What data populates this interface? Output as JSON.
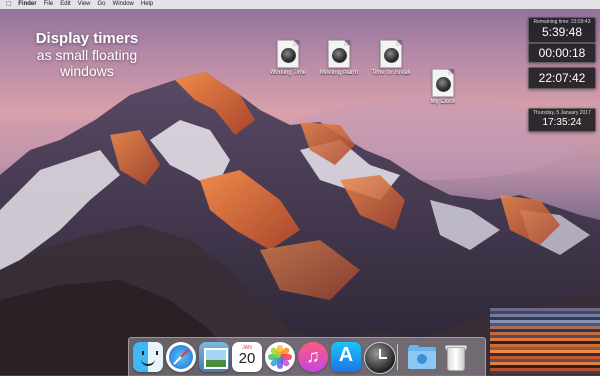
{
  "menubar": {
    "apple_icon": "apple-logo",
    "items": [
      "Finder",
      "File",
      "Edit",
      "View",
      "Go",
      "Window",
      "Help"
    ]
  },
  "promo": {
    "line1": "Display timers",
    "line2": "as small floating",
    "line3": "windows"
  },
  "desktop_icons": [
    {
      "label": "Working Time",
      "icon": "timer-document-icon"
    },
    {
      "label": "Meeting Alarm",
      "icon": "timer-document-icon"
    },
    {
      "label": "Time for Break",
      "icon": "timer-document-icon"
    },
    {
      "label": "My Clock",
      "icon": "timer-document-icon"
    }
  ],
  "widgets": {
    "remaining": {
      "caption": "Remaining time: 23:59:43",
      "value": "5:39:48"
    },
    "elapsed": {
      "value": "00:00:18"
    },
    "countdown": {
      "value": "22:07:42"
    },
    "clock": {
      "caption": "Thursday, 5 January 2017",
      "value": "17:35:24"
    }
  },
  "dock": {
    "items": [
      {
        "name": "Finder",
        "icon": "finder-icon"
      },
      {
        "name": "Safari",
        "icon": "safari-icon"
      },
      {
        "name": "Preview",
        "icon": "preview-icon"
      },
      {
        "name": "Calendar",
        "icon": "calendar-icon",
        "month": "JAN",
        "day": "20"
      },
      {
        "name": "Photos",
        "icon": "photos-icon"
      },
      {
        "name": "iTunes",
        "icon": "itunes-icon"
      },
      {
        "name": "App Store",
        "icon": "app-store-icon"
      },
      {
        "name": "Timer",
        "icon": "timer-app-icon"
      },
      {
        "name": "Downloads",
        "icon": "downloads-folder-icon"
      },
      {
        "name": "Trash",
        "icon": "trash-icon"
      }
    ]
  },
  "colors": {
    "menubar_bg": "#ebebeb",
    "widget_bg": "#19191c",
    "sky_top": "#8a6f9a",
    "sky_glow": "#d8a0aa",
    "mountain_lit": "#d9663a",
    "mountain_shadow": "#3d3548"
  }
}
